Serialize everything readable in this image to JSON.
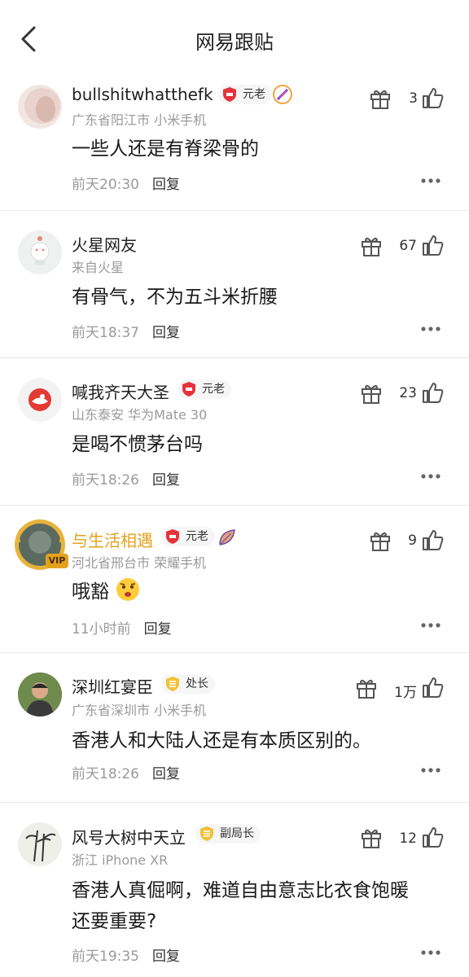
{
  "header": {
    "title": "网易跟贴"
  },
  "colors": {
    "shield_red": "#e6323a",
    "shield_gold": "#f0c23a",
    "vip_gold": "#e3a21d",
    "gray": "#9a9a9a"
  },
  "comments": [
    {
      "user": "bullshitwhatthefk",
      "badge": "元老",
      "location": "广东省阳江市  小米手机",
      "text": "一些人还是有脊梁骨的",
      "time": "前天20:30",
      "reply": "回复",
      "likes": "3"
    },
    {
      "user": "火星网友",
      "location": "来自火星",
      "text": "有骨气，不为五斗米折腰",
      "time": "前天18:37",
      "reply": "回复",
      "likes": "67"
    },
    {
      "user": "喊我齐天大圣",
      "badge": "元老",
      "location": "山东泰安  华为Mate 30",
      "text": "是喝不惯茅台吗",
      "time": "前天18:26",
      "reply": "回复",
      "likes": "23"
    },
    {
      "user": "与生活相遇",
      "badge": "元老",
      "vip": "VIP",
      "location": "河北省邢台市  荣耀手机",
      "text": "哦豁",
      "time": "11小时前",
      "reply": "回复",
      "likes": "9"
    },
    {
      "user": "深圳红宴臣",
      "badge": "处长",
      "location": "广东省深圳市  小米手机",
      "text": "香港人和大陆人还是有本质区别的。",
      "time": "前天18:26",
      "reply": "回复",
      "likes": "1万"
    },
    {
      "user": "风号大树中天立",
      "badge": "副局长",
      "location": "浙江  iPhone XR",
      "text_line1": "香港人真倔啊，难道自由意志比衣食饱暖",
      "text_line2": "还要重要?",
      "time": "前天19:35",
      "reply": "回复",
      "likes": "12"
    }
  ]
}
